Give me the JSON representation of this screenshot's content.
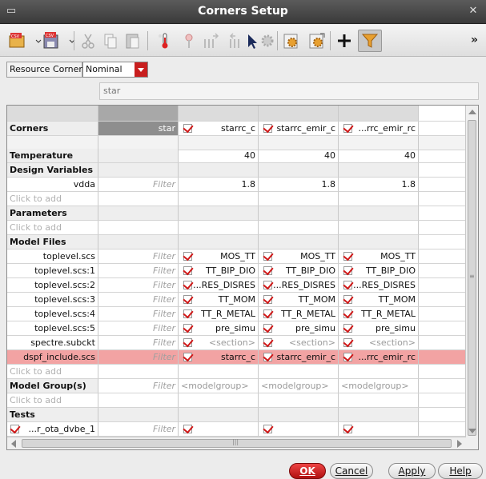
{
  "window": {
    "title": "Corners Setup"
  },
  "toolbar": {
    "icons": [
      "csv-open-icon",
      "csv-save-icon",
      "cut-icon",
      "copy-icon",
      "paste-icon",
      "temperature-icon",
      "param-icon",
      "var-add-icon",
      "var-remove-icon",
      "gear-icon",
      "settings-icon",
      "export-settings-icon",
      "add-icon",
      "filter-icon"
    ],
    "overflow": "»"
  },
  "resource_corner": {
    "label": "Resource Corner",
    "value": "Nominal"
  },
  "search": {
    "value": "star"
  },
  "grid": {
    "corners": {
      "label": "Corners",
      "filter": "star",
      "cols": [
        "starrc_c",
        "starrc_emir_c",
        "...rrc_emir_rc"
      ]
    },
    "temperature": {
      "label": "Temperature",
      "values": [
        "40",
        "40",
        "40"
      ]
    },
    "design_variables": {
      "label": "Design Variables"
    },
    "vdda": {
      "label": "vdda",
      "filter": "Filter",
      "values": [
        "1.8",
        "1.8",
        "1.8"
      ]
    },
    "click_to_add": "Click to add",
    "parameters": {
      "label": "Parameters"
    },
    "model_files": {
      "label": "Model Files"
    },
    "model_rows": [
      {
        "label": "toplevel.scs",
        "values": [
          "MOS_TT",
          "MOS_TT",
          "MOS_TT"
        ]
      },
      {
        "label": "toplevel.scs:1",
        "values": [
          "TT_BIP_DIO",
          "TT_BIP_DIO",
          "TT_BIP_DIO"
        ]
      },
      {
        "label": "toplevel.scs:2",
        "values": [
          "...RES_DISRES",
          "...RES_DISRES",
          "...RES_DISRES"
        ]
      },
      {
        "label": "toplevel.scs:3",
        "values": [
          "TT_MOM",
          "TT_MOM",
          "TT_MOM"
        ]
      },
      {
        "label": "toplevel.scs:4",
        "values": [
          "TT_R_METAL",
          "TT_R_METAL",
          "TT_R_METAL"
        ]
      },
      {
        "label": "toplevel.scs:5",
        "values": [
          "pre_simu",
          "pre_simu",
          "pre_simu"
        ]
      },
      {
        "label": "spectre.subckt",
        "values": [
          "<section>",
          "<section>",
          "<section>"
        ]
      },
      {
        "label": "dspf_include.scs",
        "values": [
          "starrc_c",
          "starrc_emir_c",
          "...rrc_emir_rc"
        ]
      }
    ],
    "filter_text": "Filter",
    "model_groups": {
      "label": "Model Group(s)",
      "filter": "Filter",
      "values": [
        "<modelgroup>",
        "<modelgroup>",
        "<modelgroup>"
      ]
    },
    "tests": {
      "label": "Tests"
    },
    "test_row": {
      "label": "...r_ota_dvbe_1",
      "filter": "Filter"
    },
    "hscroll_grip": "|||",
    "vscroll_grip": "≡"
  },
  "buttons": {
    "ok": "OK",
    "cancel": "Cancel",
    "apply": "Apply",
    "help": "Help"
  },
  "colors": {
    "accent": "#c81e1e",
    "highlight": "#f2a3a3",
    "titlebar": "#444444"
  }
}
